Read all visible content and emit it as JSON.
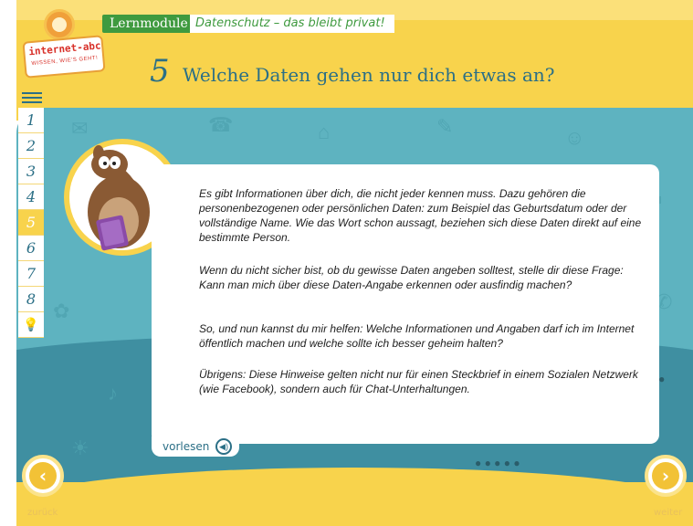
{
  "header": {
    "module_tag": "Lernmodule",
    "module_title": "Datenschutz – das bleibt privat!",
    "logo_text": "internet-abc",
    "logo_sub": "WISSEN, WIE'S GEHT!",
    "page_number": "5",
    "page_heading": "Welche Daten gehen nur dich etwas an?"
  },
  "sidebar": {
    "menu_icon": "hamburger-icon",
    "items": [
      {
        "label": "1"
      },
      {
        "label": "2"
      },
      {
        "label": "3"
      },
      {
        "label": "4"
      },
      {
        "label": "5",
        "active": true
      },
      {
        "label": "6"
      },
      {
        "label": "7"
      },
      {
        "label": "8"
      }
    ],
    "tip_icon": "lightbulb-icon"
  },
  "content": {
    "paragraphs": [
      "Es gibt Informationen über dich, die nicht jeder kennen muss. Dazu gehören die personenbezogenen oder persönlichen Daten: zum Beispiel das Geburtsdatum oder der vollständige Name. Wie das Wort schon aussagt, beziehen sich diese Daten direkt auf eine bestimmte Person.",
      "Wenn du nicht sicher bist, ob du gewisse Daten angeben solltest, stelle dir diese Frage: Kann man mich über diese Daten-Angabe erkennen oder ausfindig machen?",
      "So, und nun kannst du mir helfen: Welche Informationen und Angaben darf ich im Internet öffentlich machen und welche sollte ich besser geheim halten?",
      "Übrigens: Diese Hinweise gelten nicht nur für einen Steckbrief in einem Sozialen Netzwerk (wie Facebook), sondern auch für Chat-Unterhaltungen."
    ],
    "read_aloud_label": "vorlesen",
    "read_aloud_icon": "speaker-icon"
  },
  "footer": {
    "back_label": "zurück",
    "next_label": "weiter"
  },
  "colors": {
    "yellow": "#f8d34c",
    "teal": "#5eb3c0",
    "dark_teal": "#3f8fa1",
    "heading": "#2b6f86",
    "green_tag": "#3f9a3f"
  }
}
